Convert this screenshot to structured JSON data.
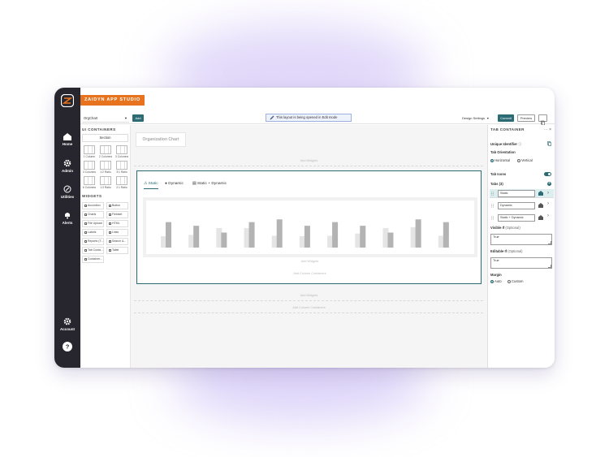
{
  "app": {
    "brand": "ZAIDYN APP STUDIO"
  },
  "nav": {
    "items": [
      {
        "label": "Home",
        "icon": "home-icon"
      },
      {
        "label": "Admin",
        "icon": "gear-icon"
      },
      {
        "label": "Utilities",
        "icon": "utilities-icon"
      },
      {
        "label": "Alerts",
        "icon": "bell-icon"
      }
    ],
    "account": {
      "label": "Account",
      "icon": "gear-icon"
    },
    "help": {
      "label": "?",
      "icon": "help-icon"
    }
  },
  "toolbar": {
    "page_select": "OrgChart",
    "add_label": "Add",
    "edit_banner": "This layout is being opened in Edit mode",
    "design_settings": "Design Settings",
    "commit_label": "Commit",
    "preview_label": "Preview"
  },
  "palette": {
    "ui_containers_heading": "UI CONTAINERS",
    "section_label": "Section",
    "layouts": [
      "1 Column",
      "2 Columns",
      "3 Columns",
      "4 Columns",
      "1:2 Ratio",
      "3:1 Ratio",
      "6 Columns",
      "1:3 Ratio",
      "2:1 Ratio"
    ],
    "widgets_heading": "WIDGETS",
    "widgets": [
      "Accordion",
      "Button",
      "Charts",
      "Fieldset",
      "File Upload",
      "HTML",
      "Labels",
      "Links",
      "Reports (T...",
      "Search &...",
      "Tab Conta...",
      "Table",
      "Container..."
    ]
  },
  "canvas": {
    "org_title": "Organization Chart",
    "add_widgets": "Add Widgets",
    "add_column_containers": "Add Column Containers",
    "tabs": [
      {
        "label": "Static",
        "active": true
      },
      {
        "label": "Dynamic",
        "active": false
      },
      {
        "label": "Static + Dynamic",
        "active": false
      }
    ]
  },
  "chart_data": {
    "type": "bar",
    "categories": [
      "",
      "",
      "",
      "",
      "",
      "",
      "",
      "",
      "",
      "",
      ""
    ],
    "series": [
      {
        "values": [
          0.25,
          0.28,
          0.43,
          0.43,
          0.26,
          0.25,
          0.26,
          0.31,
          0.43,
          0.45,
          0.26
        ],
        "color": "#e5e5e5"
      },
      {
        "values": [
          0.56,
          0.48,
          0.33,
          0.56,
          0.62,
          0.48,
          0.56,
          0.48,
          0.33,
          0.62,
          0.56
        ],
        "color": "#b3b3b3"
      }
    ],
    "ylim": [
      0,
      1
    ],
    "grid": false,
    "legend": "none"
  },
  "panel": {
    "title": "TAB CONTAINER",
    "unique_identifier": "Unique Identifier",
    "tab_orientation": "Tab Orientation",
    "horizontal": "Horizontal",
    "vertical": "Vertical",
    "tab_icons": "Tab Icons",
    "tabs_label": "Tabs (3)",
    "tab_items": [
      "Static",
      "Dynamic",
      "Static + Dynamic"
    ],
    "visible_if": "Visible If",
    "visible_if_value": "True",
    "editable_if": "Editable If",
    "editable_if_value": "True",
    "optional": "(Optional)",
    "margin": "Margin",
    "margin_auto": "Auto",
    "margin_custom": "Custom"
  },
  "colors": {
    "accent": "#2b6b73",
    "brand": "#e8731e",
    "nav_bg": "#27252d"
  }
}
